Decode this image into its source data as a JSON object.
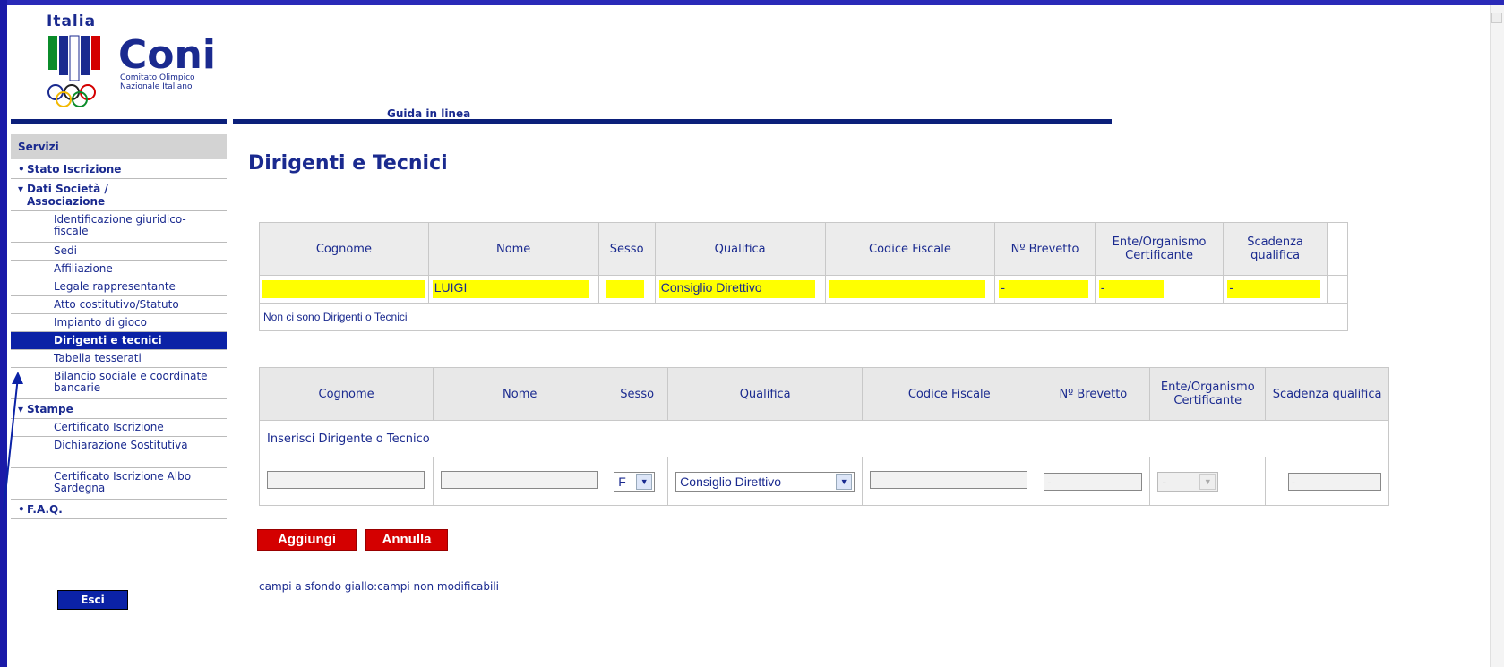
{
  "logo": {
    "italia": "Italia",
    "coni": "Coni",
    "subtitle_line1": "Comitato Olimpico",
    "subtitle_line2": "Nazionale Italiano"
  },
  "header": {
    "guida": "Guida in linea"
  },
  "sidebar": {
    "heading": "Servizi",
    "items": [
      {
        "label": "Stato Iscrizione",
        "marker": "•"
      },
      {
        "label": "Dati Società / Associazione",
        "marker": "▾"
      }
    ],
    "dati_sub": [
      {
        "label": "Identificazione giuridico-fiscale"
      },
      {
        "label": "Sedi"
      },
      {
        "label": "Affiliazione"
      },
      {
        "label": "Legale rappresentante"
      },
      {
        "label": "Atto costitutivo/Statuto"
      },
      {
        "label": "Impianto di gioco"
      },
      {
        "label": "Dirigenti e tecnici"
      },
      {
        "label": "Tabella tesserati"
      },
      {
        "label": "Bilancio sociale e coordinate bancarie"
      }
    ],
    "stampe": {
      "label": "Stampe",
      "marker": "▾"
    },
    "stampe_sub": [
      {
        "label": "Certificato Iscrizione"
      },
      {
        "label": "Dichiarazione Sostitutiva"
      },
      {
        "label": "Certificato Iscrizione Albo Sardegna"
      }
    ],
    "faq": {
      "label": "F.A.Q.",
      "marker": "•"
    },
    "esci": "Esci"
  },
  "main": {
    "title": "Dirigenti e Tecnici",
    "columns": [
      "Cognome",
      "Nome",
      "Sesso",
      "Qualifica",
      "Codice Fiscale",
      "Nº Brevetto",
      "Ente/Organismo Certificante",
      "Scadenza qualifica"
    ],
    "row": {
      "cognome": "",
      "nome": "LUIGI",
      "sesso": "",
      "qualifica": "Consiglio Direttivo",
      "codice_fiscale": "",
      "brevetto": "-",
      "ente": "-",
      "scadenza": "-"
    },
    "empty_message": "Non ci sono Dirigenti o Tecnici",
    "insert_label": "Inserisci Dirigente o Tecnico",
    "form": {
      "cognome": "",
      "nome": "",
      "sesso": "F",
      "qualifica": "Consiglio Direttivo",
      "codice_fiscale": "",
      "brevetto": "-",
      "ente": "-",
      "scadenza": "-"
    },
    "buttons": {
      "aggiungi": "Aggiungi",
      "annulla": "Annulla"
    },
    "note": "campi a sfondo giallo:campi non modificabili"
  },
  "colors": {
    "accent_blue": "#1a2a8f",
    "active_bg": "#0b22a6",
    "readonly_bg": "#ffff00",
    "button_red": "#d40000"
  }
}
